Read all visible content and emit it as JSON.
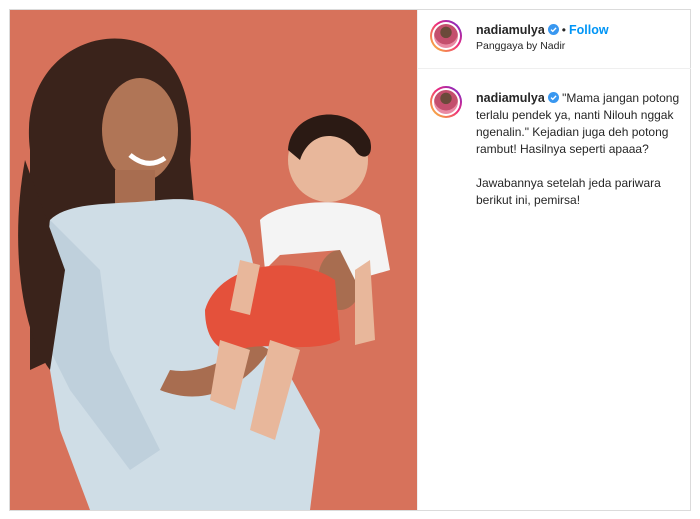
{
  "post": {
    "username": "nadiamulya",
    "verified": true,
    "follow_label": "Follow",
    "separator": "•",
    "location": "Panggaya by Nadir",
    "caption_username": "nadiamulya",
    "caption_line1": "\"Mama jangan potong terlalu pendek ya, nanti Nilouh nggak ngenalin.\" Kejadian juga deh potong rambut! Hasilnya seperti apaaa?",
    "caption_line2": "Jawabannya setelah jeda pariwara berikut ini, pemirsa!"
  },
  "icons": {
    "verified": "verified-badge-icon"
  },
  "colors": {
    "background_wall": "#d56f59",
    "follow": "#0095f6",
    "verified": "#3897f0"
  }
}
